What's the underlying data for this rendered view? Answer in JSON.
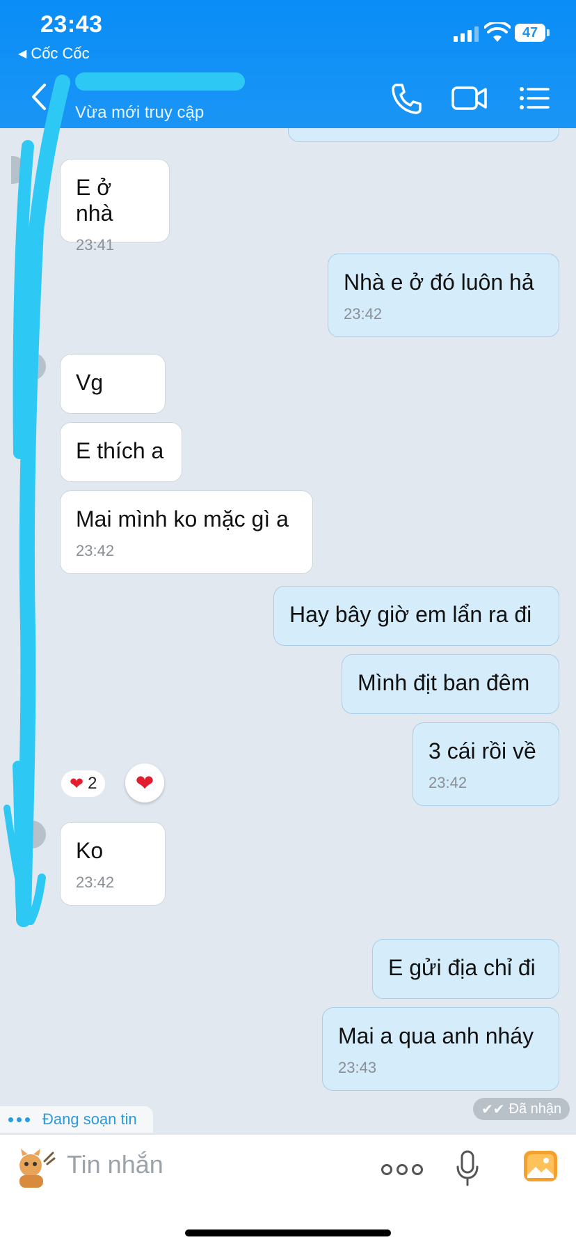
{
  "status_bar": {
    "time": "23:43",
    "back_app": "Cốc Cốc",
    "battery": "47",
    "icons": [
      "signal-icon",
      "wifi-icon",
      "battery-icon"
    ]
  },
  "header": {
    "contact_status": "Vừa mới truy cập",
    "icons": [
      "back-chevron-icon",
      "phone-icon",
      "video-call-icon",
      "menu-list-icon"
    ]
  },
  "messages": [
    {
      "side": "in",
      "text": "E ở nhà",
      "time": "23:41"
    },
    {
      "side": "out",
      "text": "Nhà e ở đó luôn hả",
      "time": "23:42"
    },
    {
      "side": "in",
      "text": "Vg",
      "time": ""
    },
    {
      "side": "in",
      "text": "E thích a",
      "time": ""
    },
    {
      "side": "in",
      "text": "Mai mình ko mặc gì a",
      "time": "23:42"
    },
    {
      "side": "out",
      "text": "Hay bây giờ em lẩn ra đi",
      "time": ""
    },
    {
      "side": "out",
      "text": "Mình địt ban đêm",
      "time": ""
    },
    {
      "side": "out",
      "text": "3 cái rồi về",
      "time": "23:42"
    },
    {
      "side": "in",
      "text": "Ko",
      "time": "23:42"
    },
    {
      "side": "out",
      "text": "E gửi địa chỉ đi",
      "time": ""
    },
    {
      "side": "out",
      "text": "Mai a qua anh nháy",
      "time": "23:43"
    }
  ],
  "reactions": {
    "count": "2",
    "emoji": "heart-icon"
  },
  "delivered_label": "Đã nhận",
  "typing_label": "Đang soạn tin",
  "composer": {
    "placeholder": "Tin nhắn",
    "icons": [
      "sticker-icon",
      "more-options-icon",
      "microphone-icon",
      "photo-gallery-icon"
    ]
  },
  "colors": {
    "header_blue": "#1a95f5",
    "outgoing_bubble": "#d5edfb",
    "incoming_bubble": "#ffffff",
    "chat_background": "#e2e8f0",
    "scribble": "#2ec8f5"
  }
}
